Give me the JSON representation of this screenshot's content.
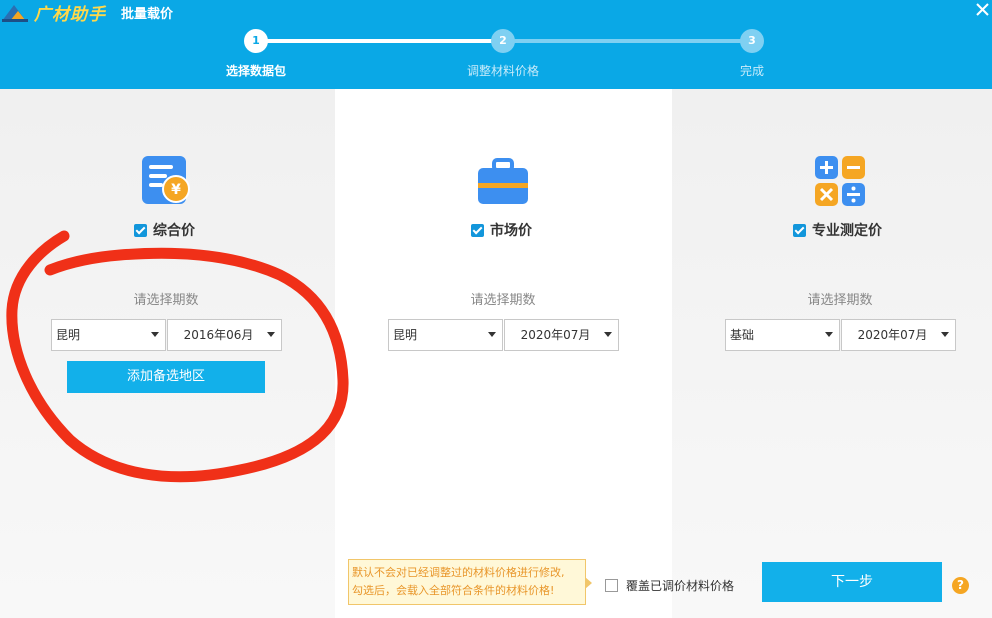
{
  "header": {
    "logo_text": "广材助手",
    "title": "批量载价",
    "close_icon": "close-icon",
    "bg_color": "#0aa8e6"
  },
  "steps": [
    {
      "number": "1",
      "label": "选择数据包",
      "state": "active"
    },
    {
      "number": "2",
      "label": "调整材料价格",
      "state": "todo"
    },
    {
      "number": "3",
      "label": "完成",
      "state": "todo"
    }
  ],
  "columns": {
    "composite": {
      "icon": "price-document-icon",
      "checkbox_label": "综合价",
      "checked": true,
      "period_label": "请选择期数",
      "region_value": "昆明",
      "period_value": "2016年06月",
      "add_region_label": "添加备选地区"
    },
    "market": {
      "icon": "briefcase-icon",
      "checkbox_label": "市场价",
      "checked": true,
      "period_label": "请选择期数",
      "region_value": "昆明",
      "period_value": "2020年07月"
    },
    "professional": {
      "icon": "calculator-icon",
      "checkbox_label": "专业测定价",
      "checked": true,
      "period_label": "请选择期数",
      "region_value": "基础",
      "period_value": "2020年07月"
    }
  },
  "footer": {
    "tooltip_line1": "默认不会对已经调整过的材料价格进行修改,",
    "tooltip_line2": "勾选后，会载入全部符合条件的材料价格!",
    "overwrite_label": "覆盖已调价材料价格",
    "overwrite_checked": false,
    "next_label": "下一步",
    "help_glyph": "?"
  },
  "colors": {
    "accent": "#0aa8e6",
    "button": "#12b0ea",
    "annotation": "#f03018",
    "warning": "#f5a623"
  }
}
